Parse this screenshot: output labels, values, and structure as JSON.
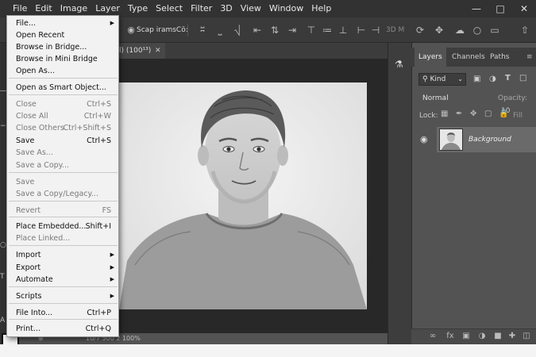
{
  "menubar": {
    "items": [
      "File",
      "Edit",
      "Image",
      "Layer",
      "Type",
      "Select",
      "Filter",
      "3D",
      "View",
      "Window",
      "Help"
    ]
  },
  "options": {
    "label": "Scap iramsCö:",
    "mode_3d": "3D M"
  },
  "document": {
    "tab_title": "l) (100¹³)",
    "status": "10/7 500 2 100%"
  },
  "layers_panel": {
    "tabs": [
      "Layers",
      "Channels",
      "Paths"
    ],
    "kind": "Kind",
    "blend_mode": "Normal",
    "opacity_label": "Opacity:",
    "opacity_value": "10",
    "lock_label": "Lock:",
    "fill_label": "Fill",
    "layer_name": "Background"
  },
  "file_menu": {
    "items": [
      {
        "label": "File...",
        "shortcut": "",
        "submenu": true,
        "disabled": false
      },
      {
        "label": "Open Recent",
        "shortcut": "",
        "submenu": false,
        "disabled": false
      },
      {
        "label": "Browse in Bridge...",
        "shortcut": "",
        "submenu": false,
        "disabled": false
      },
      {
        "label": "Browse in Mini Bridge",
        "shortcut": "",
        "submenu": false,
        "disabled": false
      },
      {
        "label": "Open As...",
        "shortcut": "",
        "submenu": false,
        "disabled": false
      },
      {
        "label": "Open as Smart Object...",
        "shortcut": "",
        "submenu": false,
        "disabled": false
      },
      {
        "label": "Close",
        "shortcut": "Ctrl+S",
        "submenu": false,
        "disabled": true
      },
      {
        "label": "Close All",
        "shortcut": "Ctrl+W",
        "submenu": false,
        "disabled": true
      },
      {
        "label": "Close Others",
        "shortcut": "Ctrl+Shift+S",
        "submenu": false,
        "disabled": true
      },
      {
        "label": "Save",
        "shortcut": "Ctrl+S",
        "submenu": false,
        "disabled": false
      },
      {
        "label": "Save As...",
        "shortcut": "",
        "submenu": false,
        "disabled": true
      },
      {
        "label": "Save a Copy...",
        "shortcut": "",
        "submenu": false,
        "disabled": true
      },
      {
        "label": "Save",
        "shortcut": "",
        "submenu": false,
        "disabled": true
      },
      {
        "label": "Save a Copy/Legacy...",
        "shortcut": "",
        "submenu": false,
        "disabled": true
      },
      {
        "label": "Revert",
        "shortcut": "FS",
        "submenu": false,
        "disabled": true
      },
      {
        "label": "Place Embedded...",
        "shortcut": "Shift+I",
        "submenu": false,
        "disabled": false
      },
      {
        "label": "Place Linked...",
        "shortcut": "",
        "submenu": false,
        "disabled": true
      },
      {
        "label": "Import",
        "shortcut": "",
        "submenu": true,
        "disabled": false
      },
      {
        "label": "Export",
        "shortcut": "",
        "submenu": true,
        "disabled": false
      },
      {
        "label": "Automate",
        "shortcut": "",
        "submenu": true,
        "disabled": false
      },
      {
        "label": "Scripts",
        "shortcut": "",
        "submenu": true,
        "disabled": false
      },
      {
        "label": "File Into...",
        "shortcut": "Ctrl+P",
        "submenu": false,
        "disabled": false
      },
      {
        "label": "Print...",
        "shortcut": "Ctrl+Q",
        "submenu": false,
        "disabled": false
      }
    ]
  },
  "colors": {
    "menubar_bg": "#323232",
    "workspace_bg": "#535353",
    "menu_bg": "#f2f2f2",
    "layer_selected": "#6a6a6a"
  }
}
